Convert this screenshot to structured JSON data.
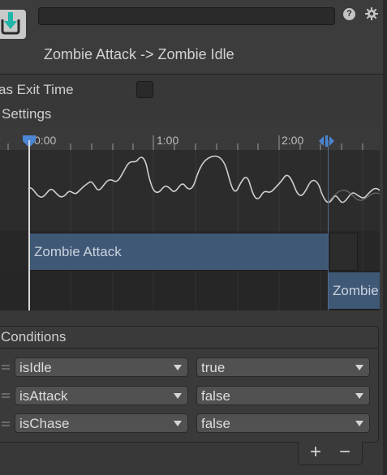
{
  "header": {
    "transition_title": "Zombie Attack -> Zombie Idle",
    "name_value": ""
  },
  "settings": {
    "has_exit_time_label": "as Exit Time",
    "has_exit_time_checked": false,
    "settings_foldout_label": "Settings"
  },
  "timeline": {
    "ruler_labels": [
      "0:00",
      "1:00",
      "2:00"
    ],
    "source_clip_label": "Zombie Attack",
    "target_clip_label": "Zombie Idle"
  },
  "conditions": {
    "title": "Conditions",
    "rows": [
      {
        "parameter": "isIdle",
        "value": "true"
      },
      {
        "parameter": "isAttack",
        "value": "false"
      },
      {
        "parameter": "isChase",
        "value": "false"
      }
    ],
    "add_label": "+",
    "remove_label": "−"
  },
  "colors": {
    "panel_bg": "#383838",
    "clip_blue": "#3f5876",
    "field_bg": "#515151"
  }
}
